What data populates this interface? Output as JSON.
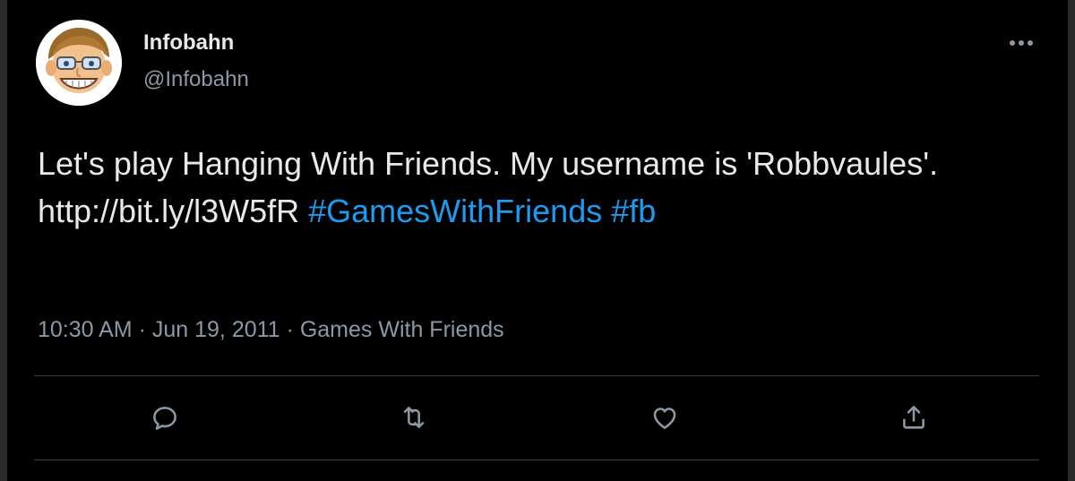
{
  "author": {
    "name": "Infobahn",
    "handle": "@Infobahn",
    "avatar_icon": "cartoon-face-avatar"
  },
  "tweet": {
    "text_parts": [
      "Let's play Hanging With Friends. My username is 'Robbvaules'. ",
      "http://bit.ly/l3W5fR",
      " ",
      "#GamesWithFriends",
      " ",
      "#fb"
    ],
    "time": "10:30 AM",
    "separator": "·",
    "date": "Jun 19, 2011",
    "source": "Games With Friends"
  },
  "actions": {
    "reply_icon": "reply-icon",
    "retweet_icon": "retweet-icon",
    "like_icon": "heart-icon",
    "share_icon": "share-icon"
  },
  "colors": {
    "background": "#000000",
    "text": "#e7e9ea",
    "secondary": "#8b98a5",
    "hashtag": "#1d9bf0",
    "divider": "#3a3f44"
  }
}
